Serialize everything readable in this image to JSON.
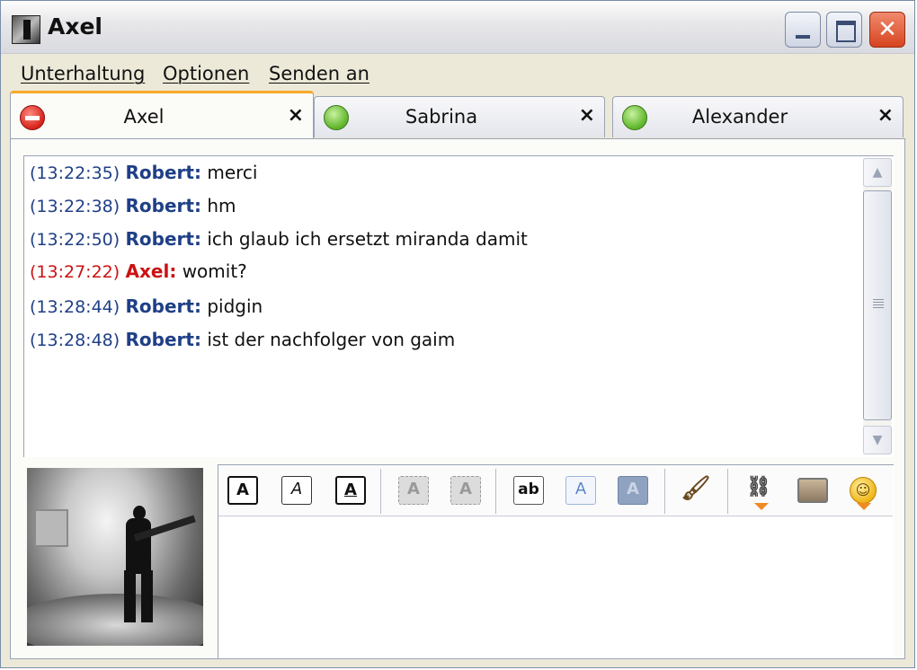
{
  "window": {
    "title": "Axel"
  },
  "menu": [
    "Unterhaltung",
    "Optionen",
    "Senden an"
  ],
  "tabs": [
    {
      "label": "Axel",
      "status": "busy",
      "close": "×"
    },
    {
      "label": "Sabrina",
      "status": "online",
      "close": "×"
    },
    {
      "label": "Alexander",
      "status": "online",
      "close": "×"
    }
  ],
  "messages": [
    {
      "time": "(13:22:35)",
      "nick": "Robert:",
      "text": "merci"
    },
    {
      "time": "(13:22:38)",
      "nick": "Robert:",
      "text": "hm"
    },
    {
      "time": "(13:22:50)",
      "nick": "Robert:",
      "text": "ich glaub ich ersetzt miranda damit"
    },
    {
      "time": "(13:27:22)",
      "nick": "Axel:",
      "text": "womit?"
    },
    {
      "time": "(13:28:44)",
      "nick": "Robert:",
      "text": "pidgin"
    },
    {
      "time": "(13:28:48)",
      "nick": "Robert:",
      "text": "ist der nachfolger von gaim"
    }
  ],
  "toolbar": {
    "bold": "A",
    "italic": "A",
    "underline": "A",
    "grow": "A",
    "shrink": "A",
    "font": "ab",
    "fg_color": "A",
    "bg_color": "A",
    "smiley": "☺"
  },
  "colors": {
    "own_nick": "#cc1111",
    "other_nick": "#1f3f86",
    "active_tab_accent": "#f7a928"
  }
}
